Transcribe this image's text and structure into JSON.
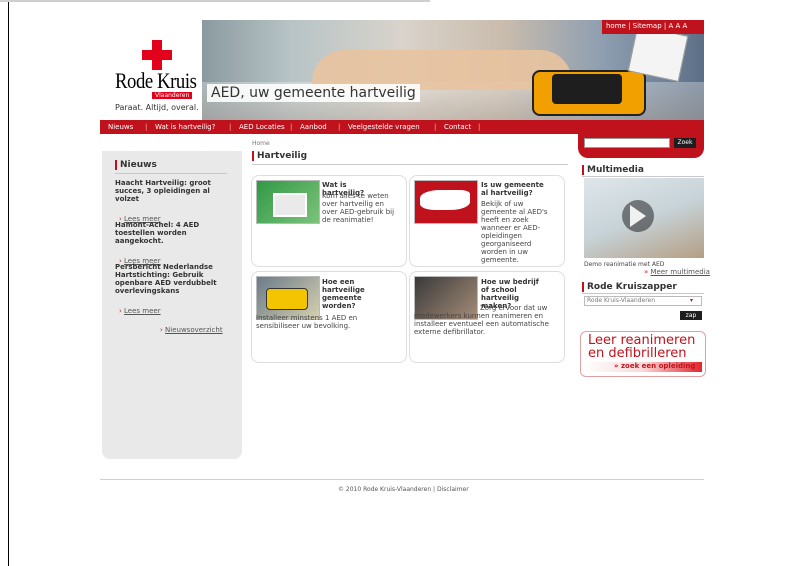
{
  "top_link": "                                    ",
  "logo": {
    "name": "Rode Kruis",
    "subname": "Vlaanderen",
    "tagline": "Paraat. Altijd, overal."
  },
  "banner": {
    "caption": "AED, uw gemeente hartveilig",
    "top_links": "home | Sitemap | A A A"
  },
  "nav": [
    "Nieuws",
    "Wat is hartveilig?",
    "AED Locaties",
    "Aanbod",
    "Veelgestelde vragen",
    "Contact"
  ],
  "search": {
    "placeholder": "",
    "button": "Zoek"
  },
  "news": {
    "title": "Nieuws",
    "items": [
      {
        "headline": "Haacht Hartveilig: groot succes, 3 opleidingen al volzet",
        "more": "Lees meer"
      },
      {
        "headline": "Hamont-Achel: 4 AED toestellen worden aangekocht.",
        "more": "Lees meer"
      },
      {
        "headline": "Persbericht Nederlandse Hartstichting: Gebruik openbare AED verdubbelt overlevingskans",
        "more": "Lees meer"
      }
    ],
    "overview": "Nieuwsoverzicht"
  },
  "main": {
    "breadcrumb": "Home",
    "title": "Hartveilig",
    "cards": [
      {
        "title": "Wat is hartveilig?",
        "text": "Kom alles te weten over hartveilig en over AED-gebruik bij de reanimatie!"
      },
      {
        "title": "Is uw gemeente al hartveilig?",
        "text": "Bekijk of uw gemeente al AED's heeft en zoek wanneer er AED-opleidingen georganiseerd worden in uw gemeente."
      },
      {
        "title": "Hoe een hartveilige gemeente worden?",
        "text": "Installeer minstens 1 AED en sensibiliseer uw bevolking."
      },
      {
        "title": "Hoe uw bedrijf of school hartveilig maken?",
        "text": "Zorg ervoor dat uw medewerkers kunnen reanimeren en installeer eventueel een automatische externe defibrillator."
      }
    ]
  },
  "multimedia": {
    "title": "Multimedia",
    "caption": "Demo reanimatie met AED",
    "more": "Meer multimedia"
  },
  "kruiszapper": {
    "title": "Rode Kruiszapper",
    "selected": "Rode Kruis-Vlaanderen",
    "button": "zap"
  },
  "promo": {
    "line1": "Leer reanimeren",
    "line2": "en defibrilleren",
    "cta": "» zoek een opleiding"
  },
  "footer": "© 2010 Rode Kruis-Vlaanderen  |  Disclaimer",
  "colors": {
    "brand_red": "#c0121c",
    "sidebar_bg": "#e9e9e9"
  }
}
